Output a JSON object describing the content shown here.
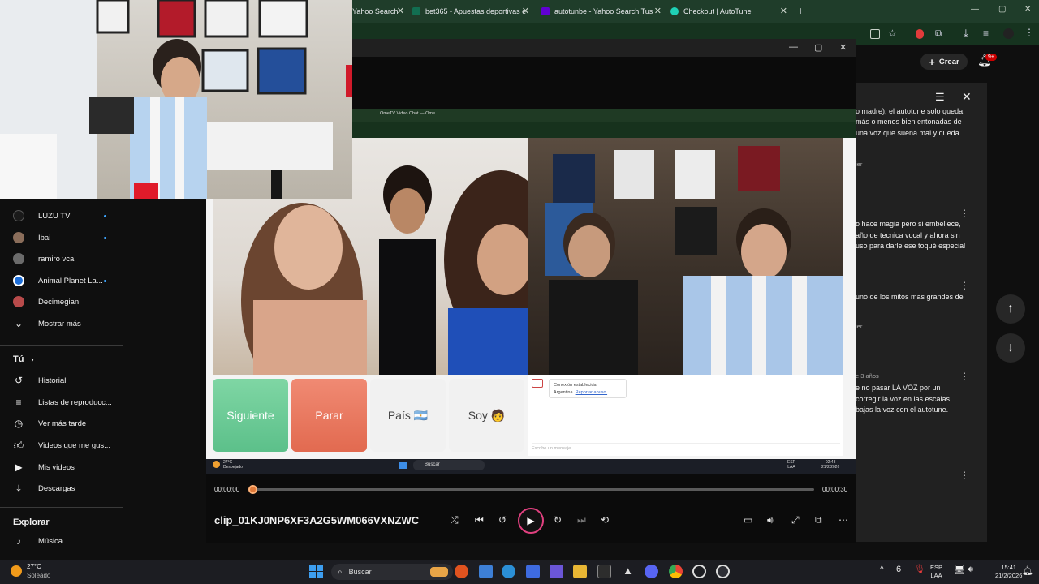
{
  "browser": {
    "tabs": [
      {
        "label": "Yahoo Search",
        "favicon_color": "#6001d2"
      },
      {
        "label": "bet365 - Apuestas deportivas e",
        "favicon_color": "#126e51"
      },
      {
        "label": "autotunbe - Yahoo Search Tus",
        "favicon_color": "#6001d2"
      },
      {
        "label": "Checkout | AutoTune",
        "favicon_color": "#1fd1b6"
      }
    ]
  },
  "sidebar": {
    "subscriptions": [
      {
        "label": "LUZU TV",
        "avatar_color": "#1a1a1a",
        "live": true
      },
      {
        "label": "Ibai",
        "avatar_color": "#8a6d5a",
        "live": true
      },
      {
        "label": "ramiro vca",
        "avatar_color": "#6b6b6b",
        "live": false
      },
      {
        "label": "Animal Planet La...",
        "avatar_color": "#1e6fd9",
        "live": true
      },
      {
        "label": "Decimegian",
        "avatar_color": "#b84b4b",
        "live": false
      }
    ],
    "show_more": "Mostrar más",
    "you_heading": "Tú",
    "you_items": [
      {
        "label": "Historial",
        "icon": "history-icon"
      },
      {
        "label": "Listas de reproducc...",
        "icon": "playlist-icon"
      },
      {
        "label": "Ver más tarde",
        "icon": "clock-icon"
      },
      {
        "label": "Videos que me gus...",
        "icon": "thumbs-up-icon"
      },
      {
        "label": "Mis videos",
        "icon": "video-icon"
      },
      {
        "label": "Descargas",
        "icon": "download-icon"
      }
    ],
    "explore_heading": "Explorar",
    "explore_items": [
      {
        "label": "Música",
        "icon": "music-icon"
      }
    ]
  },
  "header": {
    "create_label": "Crear",
    "notification_count": "9+"
  },
  "comments": [
    "más o menos bien entonadas de\nuna voz que suena mal y queda",
    "o hace magia pero si embellece,\naño de tecnica vocal y ahora sin\n uso para darle ese toqué especial",
    "uno de los mitos mas grandes de",
    "e no pasar LA VOZ por un\ncorregir la voz en las escalas\nbajas la voz con el autotune."
  ],
  "comment_meta": {
    "top_line": "o madre), el autotune solo queda",
    "reply_label_1": "ier",
    "reply_label_2": "ier",
    "timestamp": "e 3 años"
  },
  "video": {
    "inner_tab_label": "OmeTV Video Chat — Ome",
    "buttons": {
      "next": "Siguiente",
      "stop": "Parar",
      "country": "País 🇦🇷",
      "gender": "Soy 🧑"
    },
    "chat_note_title": "Conexión establecida.",
    "chat_note_country": "Argentina.",
    "chat_note_report": "Reportar abuso.",
    "chat_placeholder": "Escribe un mensaje",
    "inner_taskbar": {
      "search": "Buscar",
      "weather": "27°C",
      "weather_cond": "Despejado",
      "lang": "ESP\nLAA",
      "time": "02:48\n21/2/2026"
    }
  },
  "player": {
    "current_time": "00:00:00",
    "total_time": "00:00:30",
    "progress": 0.0,
    "clip_title": "clip_01KJ0NP6XF3A2G5WM066VXNZWC"
  },
  "taskbar": {
    "temp": "27°C",
    "condition": "Soleado",
    "search_label": "Buscar",
    "lang": "ESP\nLAA",
    "clock": "15:41\n21/2/2026"
  }
}
